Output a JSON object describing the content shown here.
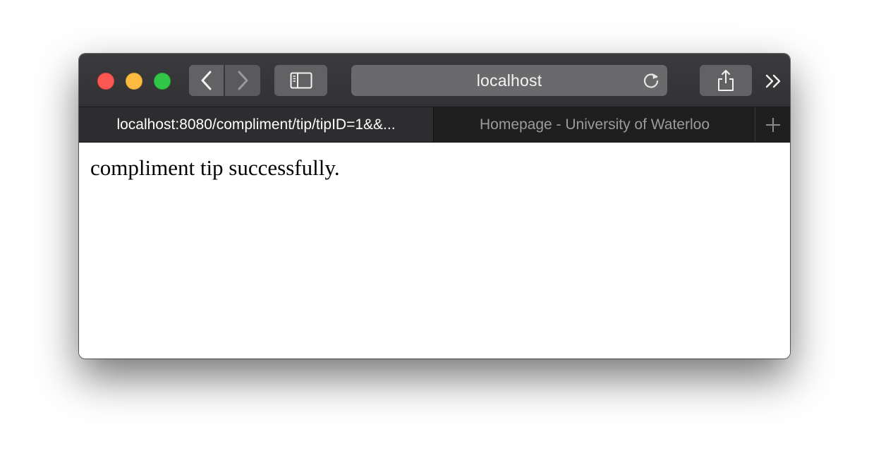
{
  "toolbar": {
    "address": "localhost"
  },
  "tabs": [
    {
      "label": "localhost:8080/compliment/tip/tipID=1&&...",
      "active": true
    },
    {
      "label": "Homepage - University of Waterloo",
      "active": false
    }
  ],
  "page": {
    "body_text": "compliment tip successfully."
  },
  "icons": {
    "back": "chevron-left-icon",
    "forward": "chevron-right-icon",
    "sidebar": "sidebar-icon",
    "reload": "reload-icon",
    "share": "share-icon",
    "more": "double-chevron-right-icon",
    "new_tab": "plus-icon"
  },
  "colors": {
    "close": "#fc5753",
    "minimize": "#fdbc40",
    "zoom": "#33c748"
  }
}
